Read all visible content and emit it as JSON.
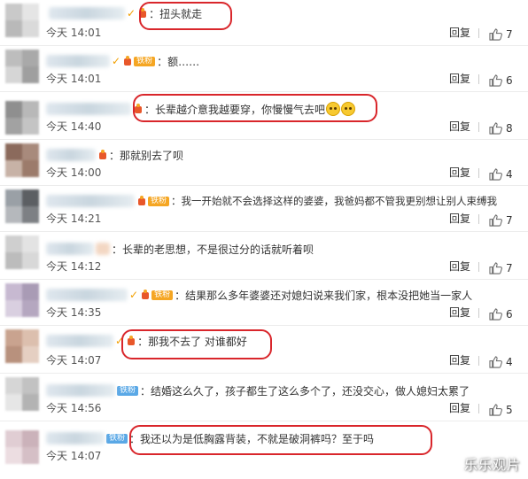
{
  "reply_label": "回复",
  "watermark": "乐乐观片",
  "comments": [
    {
      "text": "：扭头就走",
      "time": "今天 14:01",
      "likes": "7",
      "badge": "",
      "colors": [
        "#c9c9c9",
        "#e5e5e5",
        "#b9b9b9",
        "#dadada"
      ]
    },
    {
      "text": "：额……",
      "time": "今天 14:01",
      "likes": "6",
      "badge": "铁粉",
      "colors": [
        "#bdbdbd",
        "#a9a9a9",
        "#d6d6d6",
        "#9f9f9f"
      ]
    },
    {
      "text": "：长辈越介意我越要穿，你慢慢气去吧",
      "time": "今天 14:40",
      "likes": "8",
      "badge": "",
      "colors": [
        "#8f8f8f",
        "#b8b8b8",
        "#a2a2a2",
        "#c4c4c4"
      ]
    },
    {
      "text": "：那就别去了呗",
      "time": "今天 14:00",
      "likes": "4",
      "badge": "",
      "colors": [
        "#8b6a5c",
        "#a88a7c",
        "#c7b2a6",
        "#9c7b6b"
      ]
    },
    {
      "text": "：我一开始就不会选择这样的婆婆，我爸妈都不管我更别想让别人束缚我",
      "time": "今天 14:21",
      "likes": "7",
      "badge": "铁粉",
      "colors": [
        "#9aa0a6",
        "#5c5f63",
        "#b5b8bc",
        "#7d8084"
      ]
    },
    {
      "text": "：长辈的老思想，不是很过分的话就听着呗",
      "time": "今天 14:12",
      "likes": "7",
      "badge": "",
      "colors": [
        "#cfcfcf",
        "#e3e3e3",
        "#bcbcbc",
        "#d8d8d8"
      ]
    },
    {
      "text": "：结果那么多年婆婆还对媳妇说来我们家，根本没把她当一家人",
      "time": "今天 14:35",
      "likes": "6",
      "badge": "铁粉",
      "colors": [
        "#c7b9d1",
        "#a99bb5",
        "#d9cfe0",
        "#b5a7c0"
      ]
    },
    {
      "text": "：那我不去了 对谁都好",
      "time": "今天 14:07",
      "likes": "4",
      "badge": "",
      "colors": [
        "#c9a38f",
        "#dcbfae",
        "#b8917d",
        "#e5cfc2"
      ]
    },
    {
      "text": "：结婚这么久了，孩子都生了这么多个了，还没交心，做人媳妇太累了",
      "time": "今天 14:56",
      "likes": "5",
      "badge": "铁粉",
      "colors": [
        "#d6d6d6",
        "#c2c2c2",
        "#e6e6e6",
        "#b3b3b3"
      ]
    },
    {
      "text": "：我还以为是低胸露背装，不就是破洞裤吗？至于吗",
      "time": "今天 14:07",
      "likes": "",
      "badge": "铁粉",
      "colors": [
        "#e0cdd3",
        "#cbb2ba",
        "#ecdde1",
        "#d5bfc6"
      ]
    }
  ]
}
